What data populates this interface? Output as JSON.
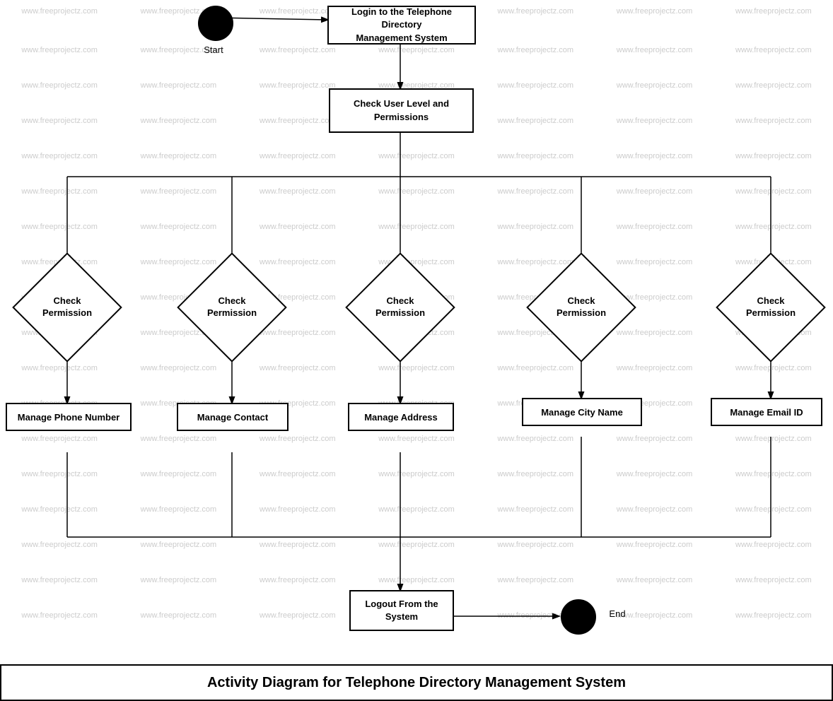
{
  "title": "Activity Diagram for Telephone Directory Management System",
  "watermark": "www.freeprojectz.com",
  "nodes": {
    "start_label": "Start",
    "login": "Login to the Telephone Directory\nManagement System",
    "check_permissions": "Check User Level and\nPermissions",
    "check_perm_1": "Check\nPermission",
    "check_perm_2": "Check\nPermission",
    "check_perm_3": "Check\nPermission",
    "check_perm_4": "Check\nPermission",
    "check_perm_5": "Check\nPermission",
    "manage_phone": "Manage Phone Number",
    "manage_contact": "Manage Contact",
    "manage_address": "Manage Address",
    "manage_city": "Manage City Name",
    "manage_email": "Manage Email ID",
    "logout": "Logout From the\nSystem",
    "end_label": "End"
  },
  "footer": {
    "text": "Activity Diagram for Telephone Directory Management System"
  }
}
